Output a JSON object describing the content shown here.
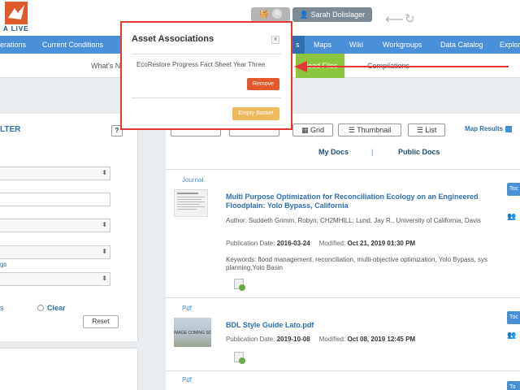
{
  "header": {
    "logo_text": "A LIVE",
    "basket_icon": "basket-icon",
    "basket_count": "0",
    "user_name": "Sarah Dolislager"
  },
  "nav": {
    "items": [
      {
        "label": "erations"
      },
      {
        "label": "Current Conditions"
      },
      {
        "label": "s"
      },
      {
        "label": "Maps"
      },
      {
        "label": "Wiki"
      },
      {
        "label": "Workgroups"
      },
      {
        "label": "Data Catalog"
      },
      {
        "label": "Explor"
      }
    ]
  },
  "subnav": {
    "whats_new": "What's N",
    "upload": "pload Files",
    "compilations": "Compilations"
  },
  "filter": {
    "title": "LTER",
    "help": "?",
    "tags_link": "gs",
    "s_link": "s",
    "clear_label": "Clear",
    "reset_label": "Reset"
  },
  "results": {
    "grid_label": "Grid",
    "thumbnail_label": "Thumbnail",
    "list_label": "List",
    "map_results_label": "Map Results",
    "my_docs": "My Docs",
    "separator": "|",
    "public_docs": "Public Docs",
    "items": [
      {
        "type": "Journal",
        "title": "Multi Purpose Optimization for Reconciliation Ecology on an Engineered Floodplain: Yolo Bypass, California",
        "author": "Author: Suddeth Grimm, Robyn; CH2MHILL; Lund, Jay R., University of California, Davis",
        "pub_label": "Publication Date:",
        "pub_date": "2016-03-24",
        "mod_label": "Modified:",
        "mod_date": "Oct 21, 2019 01:30 PM",
        "keywords": "Keywords: flood management, reconciliation, multi-objective optimization, Yolo Bypass, sys planning,Yolo Basin",
        "to_label": "Toc"
      },
      {
        "type": "Pdf",
        "title": "BDL Style Guide Lato.pdf",
        "pub_label": "Publication Date:",
        "pub_date": "2019-10-08",
        "mod_label": "Modified:",
        "mod_date": "Oct 08, 2019 12:45 PM",
        "thumb_text": "IMAGE COMING SOO",
        "to_label": "Toc"
      },
      {
        "type": "Pdf",
        "to_label": "To"
      }
    ]
  },
  "modal": {
    "title": "Asset Associations",
    "close": "x",
    "item": "EcoRestore Progress Fact Sheet Year Three",
    "remove_label": "Remove",
    "empty_label": "Empty Basket"
  },
  "colors": {
    "nav_blue": "#4a90d9",
    "annotation_red": "#e53935",
    "remove_orange": "#e25a2b",
    "empty_basket": "#f0b95e",
    "upload_green": "#8cc63f"
  }
}
